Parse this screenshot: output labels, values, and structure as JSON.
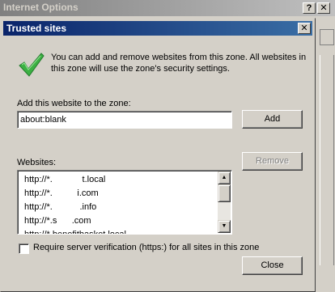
{
  "parent_window": {
    "title": "Internet Options",
    "help_glyph": "?",
    "close_glyph": "✕"
  },
  "dialog": {
    "title": "Trusted sites",
    "close_glyph": "✕",
    "icon": "checkmark-icon",
    "intro_text": "You can add and remove websites from this zone. All websites in this zone will use the zone's security settings.",
    "add_label": "Add this website to the zone:",
    "add_value": "about:blank",
    "add_button": "Add",
    "websites_label": "Websites:",
    "websites": [
      "http://*.            t.local",
      "http://*.          i.com",
      "http://*.           .info",
      "http://*.s      .com",
      "http://*.benefitbasket.local"
    ],
    "remove_button": "Remove",
    "require_https_label": "Require server verification (https:) for all sites in this zone",
    "require_https_checked": false,
    "close_button": "Close",
    "colors": {
      "active_title": "#0a246a",
      "inactive_title": "#808080",
      "face": "#d4d0c8",
      "check": "#3cb043"
    }
  }
}
